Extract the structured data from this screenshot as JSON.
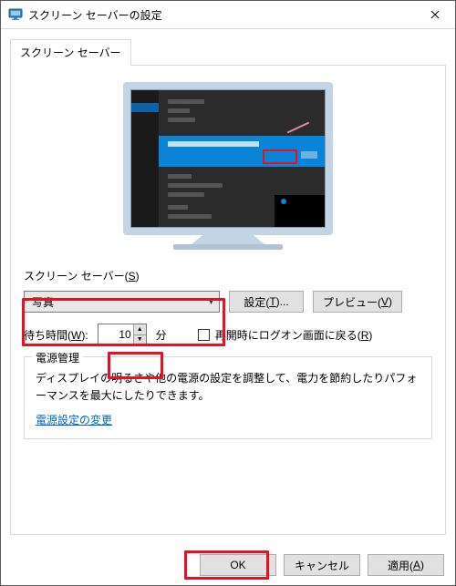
{
  "title": "スクリーン セーバーの設定",
  "tab": "スクリーン セーバー",
  "section": {
    "label": "スクリーン セーバー(S)",
    "selected": "写真",
    "settings_btn": "設定(T)...",
    "preview_btn": "プレビュー(V)"
  },
  "wait": {
    "label": "待ち時間(W):",
    "value": "10",
    "unit": "分",
    "resume_label": "再開時にログオン画面に戻る(R)"
  },
  "power": {
    "legend": "電源管理",
    "desc": "ディスプレイの明るさや他の電源の設定を調整して、電力を節約したりパフォーマンスを最大にしたりできます。",
    "link": "電源設定の変更"
  },
  "buttons": {
    "ok": "OK",
    "cancel": "キャンセル",
    "apply": "適用(A)"
  }
}
